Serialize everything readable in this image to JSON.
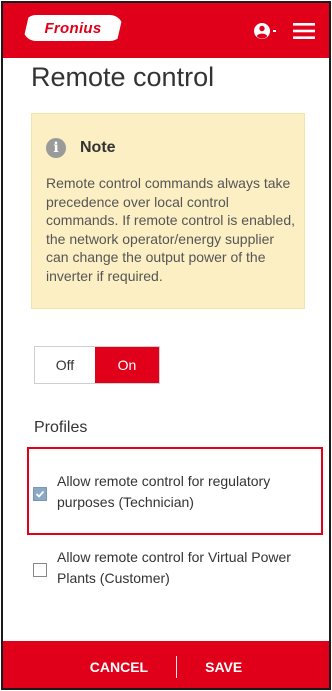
{
  "header": {
    "brand": "Fronius",
    "user_icon": "user-circle-icon",
    "menu_icon": "hamburger-menu-icon"
  },
  "page": {
    "title": "Remote control"
  },
  "note": {
    "icon": "info-icon",
    "title": "Note",
    "body": "Remote control commands always take precedence over local control commands. If remote control is enabled, the network operator/energy supplier can change the output power of the inverter if required."
  },
  "toggle": {
    "off_label": "Off",
    "on_label": "On",
    "selected": "On"
  },
  "profiles": {
    "title": "Profiles",
    "options": [
      {
        "label": "Allow remote control for regulatory purposes (Technician)",
        "checked": true
      },
      {
        "label": "Allow remote control for Virtual Power Plants (Customer)",
        "checked": false
      }
    ]
  },
  "footer": {
    "cancel_label": "CANCEL",
    "save_label": "SAVE"
  },
  "colors": {
    "brand_red": "#e1001a",
    "note_bg": "#fbefc3",
    "checkbox_checked": "#8aa9c6"
  }
}
